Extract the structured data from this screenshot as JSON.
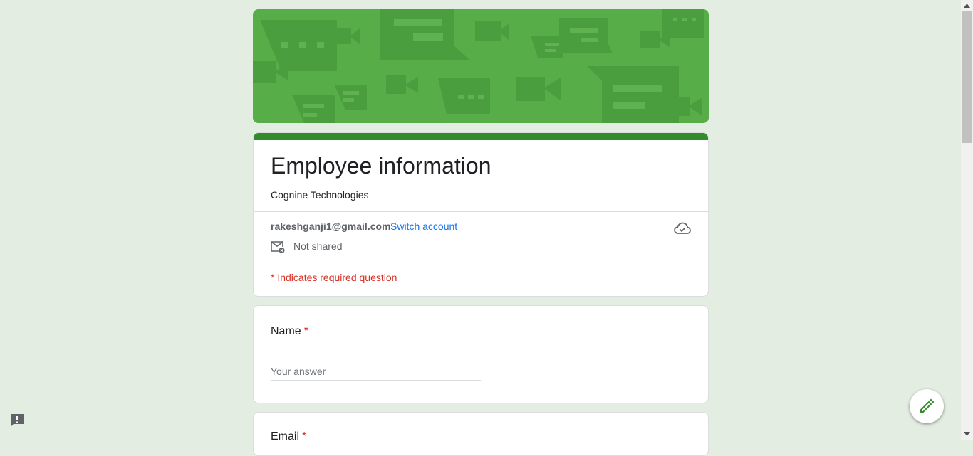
{
  "form": {
    "title": "Employee information",
    "description": "Cognine Technologies",
    "account_email": "rakeshganji1@gmail.com",
    "switch_account_label": "Switch account",
    "not_shared_label": "Not shared",
    "required_note": "* Indicates required question"
  },
  "questions": [
    {
      "title": "Name",
      "required_marker": "*",
      "placeholder": "Your answer"
    },
    {
      "title": "Email",
      "required_marker": "*"
    }
  ],
  "icons": {
    "mail": "mail-not-shared-icon",
    "cloud": "cloud-saved-icon",
    "report": "report-problem-icon",
    "edit": "pencil-icon"
  },
  "colors": {
    "page_background": "#e3ede1",
    "theme_green": "#338c2b",
    "banner_green": "#57ad47",
    "required_red": "#d93025",
    "link_blue": "#1a73e8"
  }
}
